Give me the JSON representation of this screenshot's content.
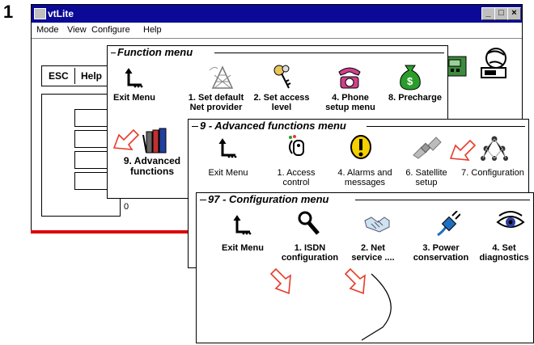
{
  "step_number": "1",
  "window": {
    "title": "vtLite",
    "min_label": "_",
    "max_label": "□",
    "close_label": "×"
  },
  "menubar": [
    "Mode",
    "View",
    "Configure",
    "Help"
  ],
  "toolbar": {
    "esc_label": "ESC",
    "help_label": "Help"
  },
  "status_value": "0",
  "function_menu": {
    "title": "Function menu",
    "items": [
      {
        "label": "Exit Menu",
        "icon": "exit-arrow-icon"
      },
      {
        "label": "1. Set default Net provider",
        "icon": "antenna-tower-icon"
      },
      {
        "label": "2. Set access level",
        "icon": "keys-icon"
      },
      {
        "label": "4. Phone setup menu",
        "icon": "telephone-icon"
      },
      {
        "label": "8. Precharge",
        "icon": "money-bag-icon"
      },
      {
        "label": "9. Advanced functions",
        "icon": "books-icon"
      }
    ]
  },
  "advanced_menu": {
    "title": "9 - Advanced functions menu",
    "items": [
      {
        "label": "Exit Menu",
        "icon": "exit-arrow-icon"
      },
      {
        "label": "1. Access control",
        "icon": "access-control-icon"
      },
      {
        "label": "4. Alarms and messages",
        "icon": "alarm-icon"
      },
      {
        "label": "6. Satellite setup",
        "icon": "satellite-icon"
      },
      {
        "label": "7. Configuration",
        "icon": "configuration-network-icon"
      }
    ]
  },
  "config_menu": {
    "title": "97 - Configuration menu",
    "items": [
      {
        "label": "Exit Menu",
        "icon": "exit-arrow-icon"
      },
      {
        "label": "1. ISDN configuration",
        "icon": "isdn-handset-icon"
      },
      {
        "label": "2. Net service ....",
        "icon": "handshake-icon"
      },
      {
        "label": "3. Power conservation",
        "icon": "power-plug-icon"
      },
      {
        "label": "4. Set diagnostics",
        "icon": "eye-icon"
      }
    ]
  },
  "colors": {
    "titlebar": "#0a0a96",
    "arrow": "#e83a2a",
    "red_line": "#dd0000",
    "money": "#2a9d2a",
    "alarm": "#f4d000"
  }
}
